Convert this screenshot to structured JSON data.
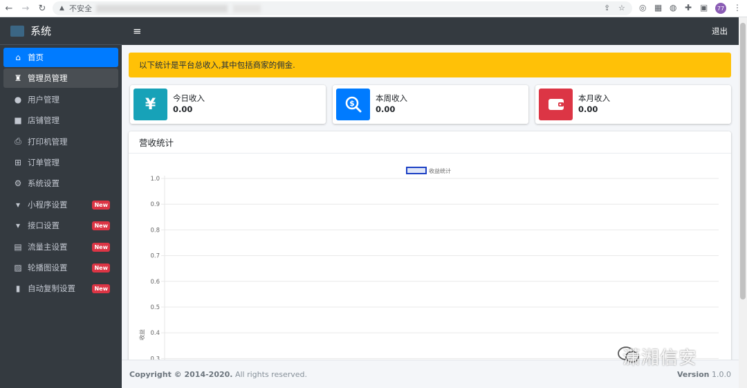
{
  "browser": {
    "back_icon": "arrow-left-icon",
    "security_label": "不安全",
    "profile_initials": "77"
  },
  "brand": {
    "title": "系统"
  },
  "sidebar": {
    "items": [
      {
        "label": "首页",
        "icon": "home-icon",
        "state": "active"
      },
      {
        "label": "管理员管理",
        "icon": "user-tie-icon",
        "state": "open"
      },
      {
        "label": "用户管理",
        "icon": "user-icon"
      },
      {
        "label": "店铺管理",
        "icon": "shopping-bag-icon"
      },
      {
        "label": "打印机管理",
        "icon": "printer-icon"
      },
      {
        "label": "订单管理",
        "icon": "basket-icon"
      },
      {
        "label": "系统设置",
        "icon": "gears-icon"
      },
      {
        "label": "小程序设置",
        "icon": "trophy-icon",
        "badge": "New"
      },
      {
        "label": "接口设置",
        "icon": "trophy-icon",
        "badge": "New"
      },
      {
        "label": "流量主设置",
        "icon": "ad-icon",
        "badge": "New"
      },
      {
        "label": "轮播图设置",
        "icon": "image-icon",
        "badge": "New"
      },
      {
        "label": "自动复制设置",
        "icon": "clipboard-icon",
        "badge": "New"
      }
    ]
  },
  "topnav": {
    "logout_label": "退出"
  },
  "alert": {
    "text": "以下统计是平台总收入,其中包括商家的佣金."
  },
  "info_boxes": [
    {
      "label": "今日收入",
      "value": "0.00",
      "icon": "yen-icon",
      "color": "#17a2b8"
    },
    {
      "label": "本周收入",
      "value": "0.00",
      "icon": "search-dollar-icon",
      "color": "#007bff"
    },
    {
      "label": "本月收入",
      "value": "0.00",
      "icon": "wallet-icon",
      "color": "#dc3545"
    }
  ],
  "revenue_card": {
    "title": "营收统计"
  },
  "chart_data": {
    "type": "line",
    "series": [
      {
        "name": "收益统计",
        "values": []
      }
    ],
    "legend": "top-center",
    "ylabel": "收益",
    "y_ticks": [
      "1.0",
      "0.9",
      "0.8",
      "0.7",
      "0.6",
      "0.5",
      "0.4",
      "0.3"
    ],
    "ylim": [
      0.3,
      1.0
    ],
    "grid": true,
    "colors": {
      "series_border": "#1a3fc4",
      "series_fill": "#dfe6f7"
    }
  },
  "footer": {
    "copyright_bold": "Copyright © 2014-2020.",
    "copyright_rest": " All rights reserved.",
    "version_label": "Version",
    "version_value": "1.0.0"
  },
  "watermark": {
    "text": "潇湘信安"
  }
}
